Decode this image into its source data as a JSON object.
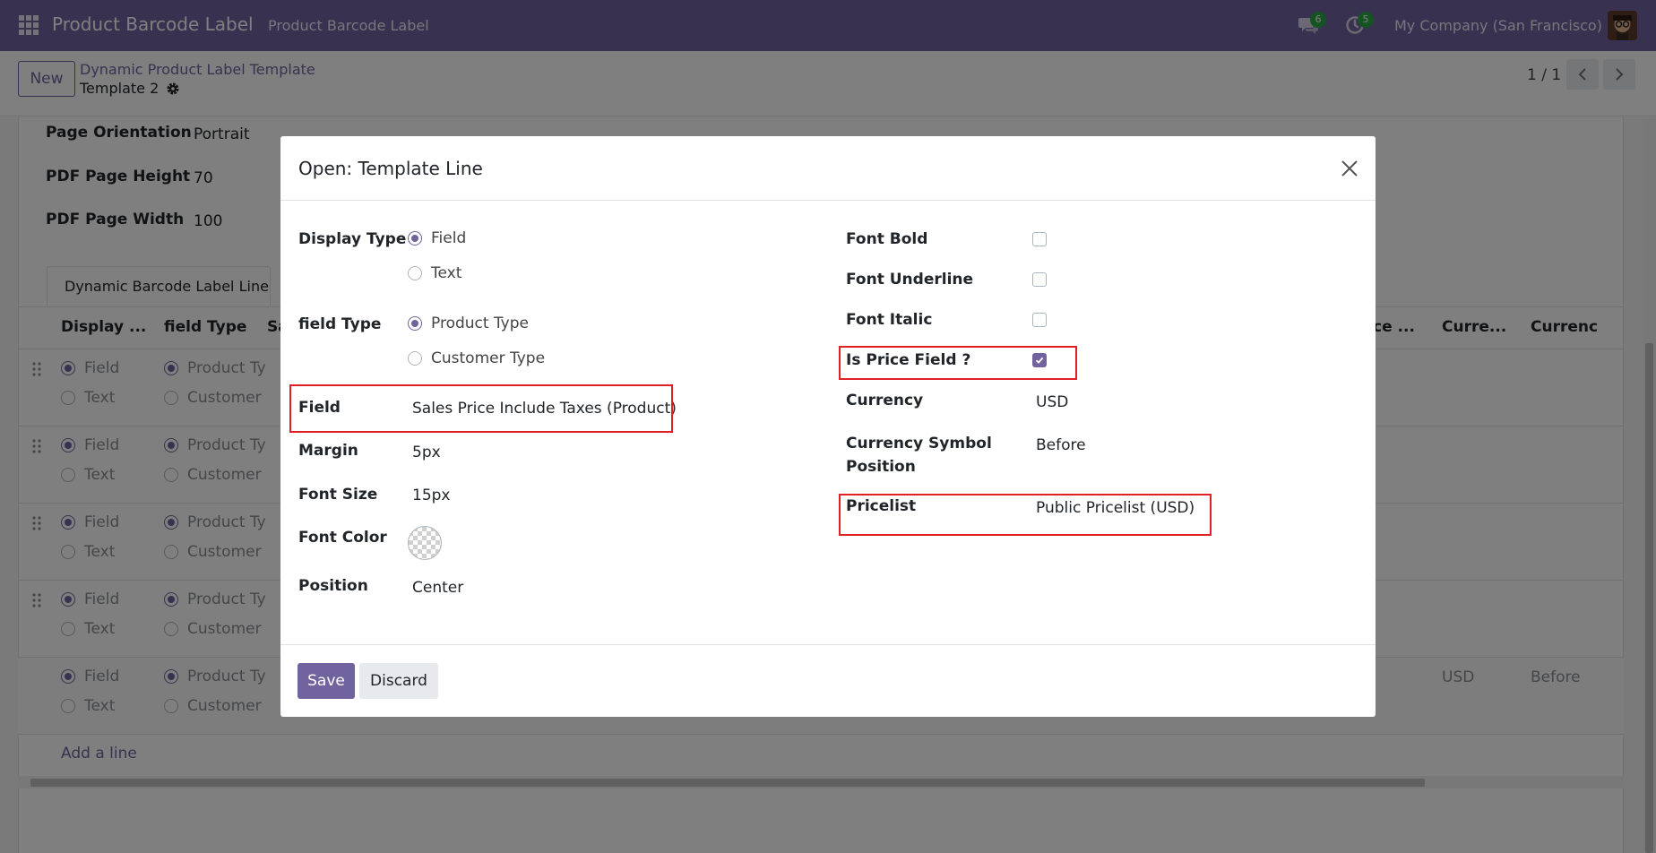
{
  "navbar": {
    "brand": "Product Barcode Label",
    "menu_item": "Product Barcode Label",
    "chat_count": "6",
    "activity_count": "5",
    "company": "My Company (San Francisco)"
  },
  "control": {
    "new_label": "New",
    "breadcrumb_parent": "Dynamic Product Label Template",
    "breadcrumb_current": "Template 2",
    "pager": "1 / 1"
  },
  "background_form": {
    "fields": [
      {
        "label": "Page Orientation",
        "value": "Portrait"
      },
      {
        "label": "PDF Page Height",
        "value": "70"
      },
      {
        "label": "PDF Page Width",
        "value": "100"
      }
    ],
    "tab": "Dynamic Barcode Label Line",
    "columns": [
      "Display ...",
      "field Type",
      "Sa",
      "ce ...",
      "Curre...",
      "Currenc"
    ],
    "row_option_field": "Field",
    "row_option_text": "Text",
    "row_option_product": "Product Ty",
    "row_option_customer": "Customer",
    "last_row_currency": "USD",
    "last_row_position": "Before",
    "add_line": "Add a line"
  },
  "modal": {
    "title": "Open: Template Line",
    "left": {
      "display_type_label": "Display Type",
      "display_type_options": [
        "Field",
        "Text"
      ],
      "display_type_selected": "Field",
      "field_type_label": "field Type",
      "field_type_options": [
        "Product Type",
        "Customer Type"
      ],
      "field_type_selected": "Product Type",
      "field_label": "Field",
      "field_value": "Sales Price Include Taxes (Product)",
      "margin_label": "Margin",
      "margin_value": "5px",
      "font_size_label": "Font Size",
      "font_size_value": "15px",
      "font_color_label": "Font Color",
      "position_label": "Position",
      "position_value": "Center"
    },
    "right": {
      "font_bold_label": "Font Bold",
      "font_bold": false,
      "font_underline_label": "Font Underline",
      "font_underline": false,
      "font_italic_label": "Font Italic",
      "font_italic": false,
      "is_price_label": "Is Price Field ?",
      "is_price": true,
      "currency_label": "Currency",
      "currency_value": "USD",
      "currency_symbol_label": "Currency Symbol Position",
      "currency_symbol_value": "Before",
      "pricelist_label": "Pricelist",
      "pricelist_value": "Public Pricelist (USD)"
    },
    "save_label": "Save",
    "discard_label": "Discard"
  },
  "colors": {
    "brand": "#71639e",
    "highlight": "#e01f26",
    "badge": "#28a745"
  }
}
